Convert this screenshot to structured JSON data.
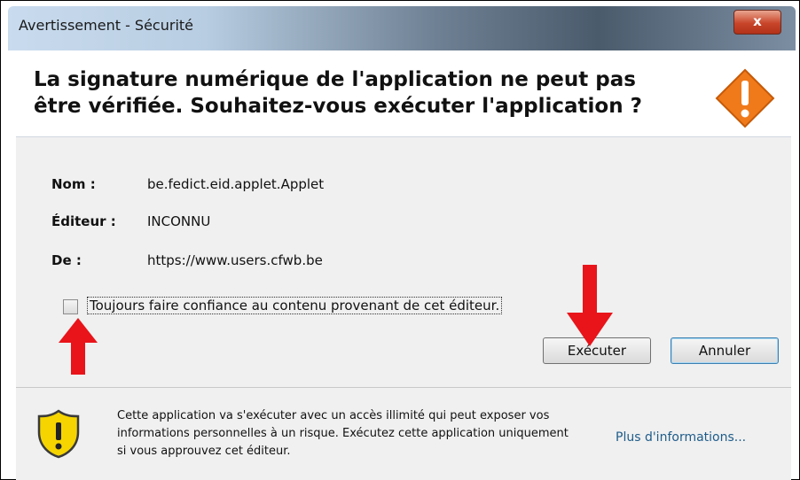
{
  "window": {
    "title": "Avertissement - Sécurité",
    "close_label": "x"
  },
  "header": {
    "message": "La signature numérique de l'application ne peut pas être vérifiée.  Souhaitez-vous exécuter l'application ?"
  },
  "details": {
    "name_label": "Nom :",
    "name_value": "be.fedict.eid.applet.Applet",
    "publisher_label": "Éditeur :",
    "publisher_value": "INCONNU",
    "from_label": "De :",
    "from_value": "https://www.users.cfwb.be"
  },
  "trust_checkbox": {
    "label": "Toujours faire confiance au contenu provenant de cet éditeur.",
    "checked": false
  },
  "buttons": {
    "run": "Exécuter",
    "cancel": "Annuler"
  },
  "footer": {
    "warning_text": "Cette application va s'exécuter avec un accès illimité qui peut exposer vos informations personnelles à un risque. Exécutez cette application uniquement si vous approuvez cet éditeur.",
    "more_info_link": "Plus d'informations..."
  },
  "colors": {
    "annotation_arrow": "#e8141a",
    "warning_orange": "#f07a1a",
    "shield_yellow": "#f5d400"
  },
  "icons": {
    "header": "warning-diamond-icon",
    "footer": "security-shield-icon",
    "annotations": "red-arrow-icon"
  }
}
